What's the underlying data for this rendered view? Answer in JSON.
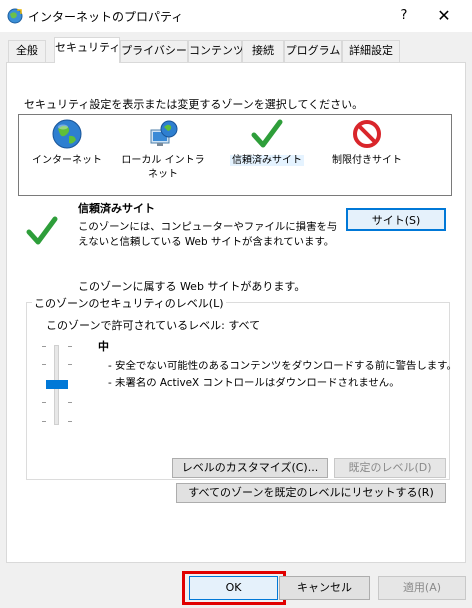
{
  "window": {
    "title": "インターネットのプロパティ",
    "help_label": "?",
    "close_label": "✕"
  },
  "tabs": [
    {
      "label": "全般",
      "active": false
    },
    {
      "label": "セキュリティ",
      "active": true
    },
    {
      "label": "プライバシー",
      "active": false
    },
    {
      "label": "コンテンツ",
      "active": false
    },
    {
      "label": "接続",
      "active": false
    },
    {
      "label": "プログラム",
      "active": false
    },
    {
      "label": "詳細設定",
      "active": false
    }
  ],
  "zone_instruction": "セキュリティ設定を表示または変更するゾーンを選択してください。",
  "zones": [
    {
      "label": "インターネット",
      "icon": "globe-icon"
    },
    {
      "label": "ローカル イントラネット",
      "icon": "intranet-icon"
    },
    {
      "label": "信頼済みサイト",
      "icon": "checkmark-icon",
      "selected": true
    },
    {
      "label": "制限付きサイト",
      "icon": "restricted-icon"
    }
  ],
  "selected_zone": {
    "title": "信頼済みサイト",
    "description": "このゾーンには、コンピューターやファイルに損害を与えないと信頼している Web サイトが含まれています。",
    "sites_button": "サイト(S)",
    "sites_note": "このゾーンに属する Web サイトがあります。"
  },
  "security_level": {
    "group_label": "このゾーンのセキュリティのレベル(L)",
    "allowed_level": "このゾーンで許可されているレベル: すべて",
    "level_name": "中",
    "descriptions": [
      "- 安全でない可能性のあるコンテンツをダウンロードする前に警告します。",
      "- 未署名の ActiveX コントロールはダウンロードされません。"
    ],
    "custom_level_button": "レベルのカスタマイズ(C)...",
    "default_level_button": "既定のレベル(D)",
    "reset_all_button": "すべてのゾーンを既定のレベルにリセットする(R)"
  },
  "footer": {
    "ok_label": "OK",
    "cancel_label": "キャンセル",
    "apply_label": "適用(A)"
  },
  "colors": {
    "accent": "#0078d7",
    "highlight_red": "#e00000",
    "check_green": "#2e9e3a",
    "restricted_red": "#d9262b"
  }
}
